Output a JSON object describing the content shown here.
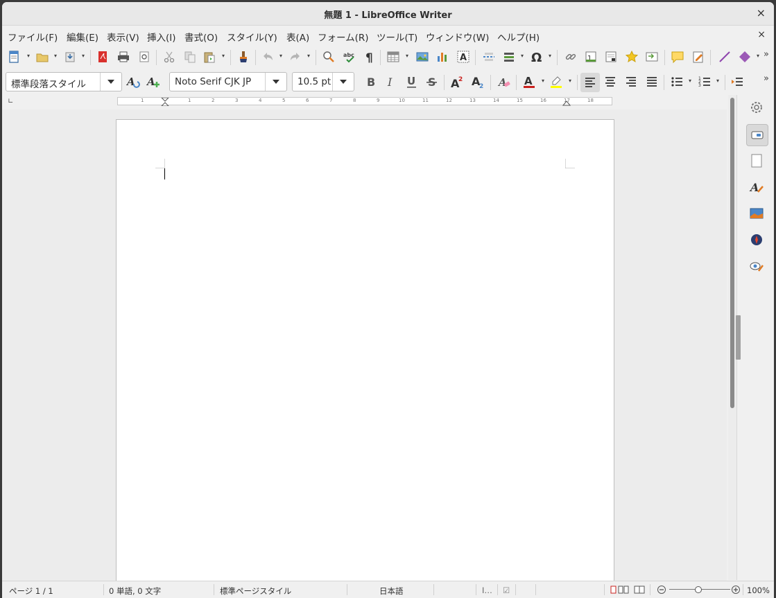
{
  "window": {
    "title": "無題 1 - LibreOffice Writer",
    "close": "×"
  },
  "menubar": {
    "items": [
      "ファイル(F)",
      "編集(E)",
      "表示(V)",
      "挿入(I)",
      "書式(O)",
      "スタイル(Y)",
      "表(A)",
      "フォーム(R)",
      "ツール(T)",
      "ウィンドウ(W)",
      "ヘルプ(H)"
    ],
    "close_document": "×"
  },
  "formatting": {
    "paragraph_style": "標準段落スタイル",
    "font_name": "Noto Serif CJK JP",
    "font_size": "10.5 pt"
  },
  "toolbar_icons": [
    "new-document-icon",
    "open-folder-icon",
    "save-icon",
    "export-pdf-icon",
    "print-icon",
    "print-preview-icon",
    "cut-icon",
    "copy-icon",
    "paste-icon",
    "clone-formatting-icon",
    "undo-icon",
    "redo-icon",
    "find-replace-icon",
    "spellcheck-icon",
    "formatting-marks-icon",
    "insert-table-icon",
    "insert-image-icon",
    "insert-chart-icon",
    "insert-textbox-icon",
    "page-break-icon",
    "insert-field-icon",
    "special-character-icon",
    "hyperlink-icon",
    "footnote-icon",
    "endnote-icon",
    "bookmark-icon",
    "cross-reference-icon",
    "comment-icon",
    "track-changes-icon",
    "line-icon",
    "basic-shapes-icon"
  ],
  "ruler": {
    "numbers": [
      "1",
      "1",
      "2",
      "3",
      "4",
      "5",
      "6",
      "7",
      "8",
      "9",
      "10",
      "11",
      "12",
      "13",
      "14",
      "15",
      "16",
      "17",
      "18"
    ]
  },
  "statusbar": {
    "page": "ページ 1 / 1",
    "word_count": "0 単語, 0 文字",
    "page_style": "標準ページスタイル",
    "language": "日本語",
    "zoom": "100%"
  },
  "colors": {
    "font_color": "#c9211e",
    "highlight_color": "#ffff00",
    "accent": "#4a86c8"
  }
}
